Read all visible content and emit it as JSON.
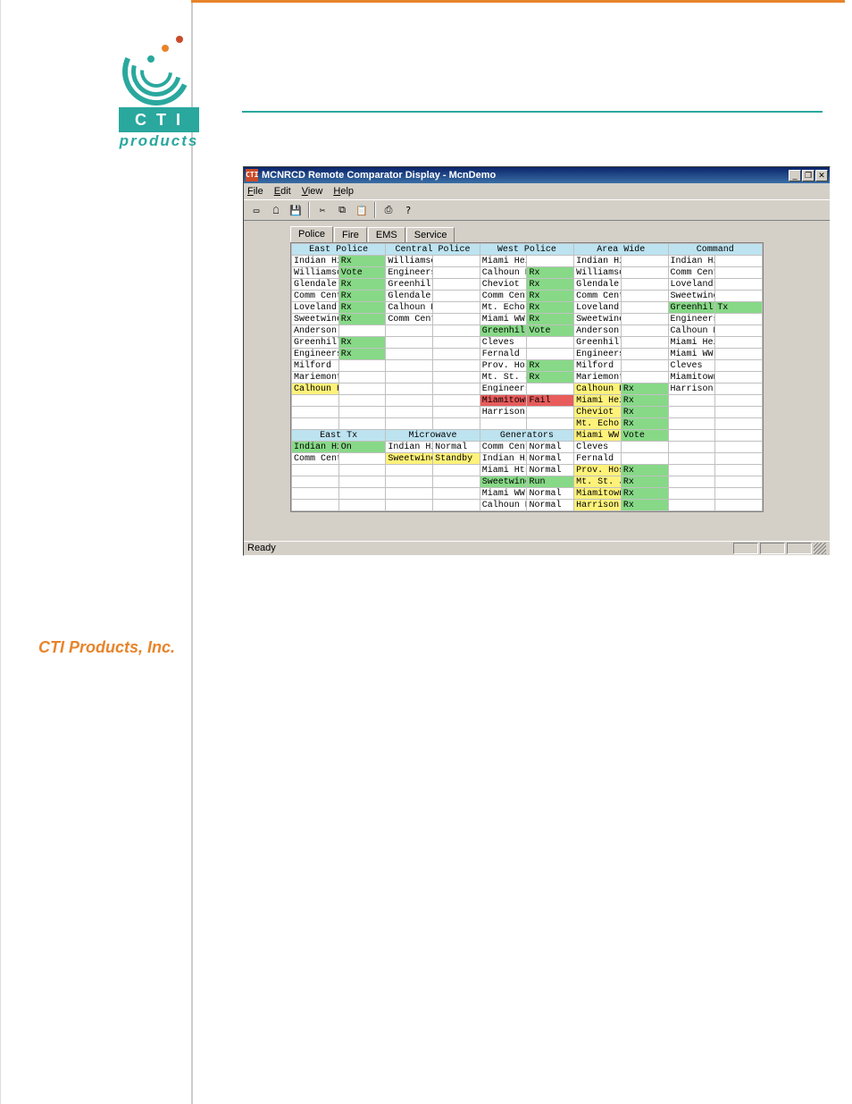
{
  "logo": {
    "bar": "C T I",
    "sub": "products"
  },
  "company": "CTI Products, Inc.",
  "window": {
    "title": "MCNRCD Remote Comparator Display - McnDemo",
    "ticon": "CTI",
    "menus": [
      "File",
      "Edit",
      "View",
      "Help"
    ],
    "toolbar": [
      "new",
      "open",
      "save",
      "|",
      "cut",
      "copy",
      "paste",
      "|",
      "print",
      "help"
    ],
    "tabs": [
      "Police",
      "Fire",
      "EMS",
      "Service"
    ],
    "active_tab": 0,
    "status": "Ready",
    "winbtns": [
      "_",
      "❐",
      "✕"
    ]
  },
  "columns": [
    {
      "headers": [
        "East Police"
      ],
      "type": "site",
      "rows": [
        {
          "n": "Indian Hill",
          "s": "Rx",
          "c": "rx"
        },
        {
          "n": "Williamson Rd.",
          "s": "Vote",
          "c": "vote"
        },
        {
          "n": "Glendale W.T.",
          "s": "Rx",
          "c": "rx"
        },
        {
          "n": "Comm Center",
          "s": "Rx",
          "c": "rx"
        },
        {
          "n": "Loveland W.T.",
          "s": "Rx",
          "c": "rx"
        },
        {
          "n": "Sweetwine",
          "s": "Rx",
          "c": "rx"
        },
        {
          "n": "Anderson Twp",
          "s": ""
        },
        {
          "n": "Greenhills",
          "s": "Rx",
          "c": "rx"
        },
        {
          "n": "Engineers",
          "s": "Rx",
          "c": "rx"
        },
        {
          "n": "Milford",
          "s": ""
        },
        {
          "n": "Mariemont",
          "s": ""
        },
        {
          "n": "Calhoun Hall",
          "s": "",
          "nc": "yel"
        },
        {
          "n": "",
          "s": ""
        },
        {
          "n": "",
          "s": ""
        },
        {
          "n": "",
          "s": ""
        }
      ],
      "headers2": [
        "East Tx"
      ],
      "rows2": [
        {
          "n": "Indian Hill",
          "s": "On",
          "c": "on",
          "nc": "rx"
        },
        {
          "n": "Comm Center",
          "s": ""
        },
        {
          "n": "",
          "s": ""
        },
        {
          "n": "",
          "s": ""
        },
        {
          "n": "",
          "s": ""
        },
        {
          "n": "",
          "s": ""
        }
      ]
    },
    {
      "headers": [
        "Central Police"
      ],
      "type": "site",
      "rows": [
        {
          "n": "Williamson Rd.",
          "s": ""
        },
        {
          "n": "Engineers",
          "s": ""
        },
        {
          "n": "Greenhills",
          "s": ""
        },
        {
          "n": "Glendale W.T.",
          "s": ""
        },
        {
          "n": "Calhoun Hall",
          "s": ""
        },
        {
          "n": "Comm Center",
          "s": ""
        },
        {
          "n": "",
          "s": ""
        },
        {
          "n": "",
          "s": ""
        },
        {
          "n": "",
          "s": ""
        },
        {
          "n": "",
          "s": ""
        },
        {
          "n": "",
          "s": ""
        },
        {
          "n": "",
          "s": ""
        },
        {
          "n": "",
          "s": ""
        },
        {
          "n": "",
          "s": ""
        },
        {
          "n": "",
          "s": ""
        }
      ],
      "headers2": [
        "Microwave"
      ],
      "rows2": [
        {
          "n": "Indian Hill",
          "s": "Normal"
        },
        {
          "n": "Sweetwine",
          "s": "Standby",
          "c": "stb",
          "nc": "yel"
        },
        {
          "n": "",
          "s": ""
        },
        {
          "n": "",
          "s": ""
        },
        {
          "n": "",
          "s": ""
        },
        {
          "n": "",
          "s": ""
        }
      ]
    },
    {
      "headers": [
        "West Police"
      ],
      "type": "site",
      "rows": [
        {
          "n": "Miami Heights",
          "s": ""
        },
        {
          "n": "Calhoun Hall",
          "s": "Rx",
          "c": "rx"
        },
        {
          "n": "Cheviot",
          "s": "Rx",
          "c": "rx"
        },
        {
          "n": "Comm Center",
          "s": "Rx",
          "c": "rx"
        },
        {
          "n": "Mt. Echo",
          "s": "Rx",
          "c": "rx"
        },
        {
          "n": "Miami WW",
          "s": "Rx",
          "c": "rx"
        },
        {
          "n": "Greenhills",
          "s": "Vote",
          "c": "vote",
          "nc": "rx"
        },
        {
          "n": "Cleves",
          "s": ""
        },
        {
          "n": "Fernald",
          "s": ""
        },
        {
          "n": "Prov. Hosp.",
          "s": "Rx",
          "c": "rx"
        },
        {
          "n": "Mt. St. Joesph",
          "s": "Rx",
          "c": "rx"
        },
        {
          "n": "Engineers",
          "s": ""
        },
        {
          "n": "Miamitown",
          "s": "Fail",
          "c": "fail",
          "nc": "fail"
        },
        {
          "n": "Harrison",
          "s": ""
        },
        {
          "n": "",
          "s": ""
        }
      ],
      "headers2": [
        "Generators"
      ],
      "rows2": [
        {
          "n": "Comm Center",
          "s": "Normal"
        },
        {
          "n": "Indian Hill",
          "s": "Normal"
        },
        {
          "n": "Miami Hts",
          "s": "Normal"
        },
        {
          "n": "Sweetwine",
          "s": "Run",
          "c": "run",
          "nc": "rx"
        },
        {
          "n": "Miami WW",
          "s": "Normal"
        },
        {
          "n": "Calhoun Hall",
          "s": "Normal"
        }
      ]
    },
    {
      "headers": [
        "Area Wide"
      ],
      "type": "site",
      "rows": [
        {
          "n": "Indian Hill",
          "s": ""
        },
        {
          "n": "Williamson Rd",
          "s": ""
        },
        {
          "n": "Glendale W.T.",
          "s": ""
        },
        {
          "n": "Comm Center",
          "s": ""
        },
        {
          "n": "Loveland W.T.",
          "s": ""
        },
        {
          "n": "Sweetwine",
          "s": ""
        },
        {
          "n": "Anderson Twp.",
          "s": ""
        },
        {
          "n": "Greenhills",
          "s": ""
        },
        {
          "n": "Engineers",
          "s": ""
        },
        {
          "n": "Milford",
          "s": ""
        },
        {
          "n": "Mariemont",
          "s": ""
        },
        {
          "n": "Calhoun Hall",
          "s": "Rx",
          "c": "rx",
          "nc": "yel"
        },
        {
          "n": "Miami Heights",
          "s": "Rx",
          "c": "rx",
          "nc": "yel"
        },
        {
          "n": "Cheviot",
          "s": "Rx",
          "c": "rx",
          "nc": "yel"
        },
        {
          "n": "Mt. Echo",
          "s": "Rx",
          "c": "rx",
          "nc": "yel"
        },
        {
          "n": "Miami WW",
          "s": "Vote",
          "c": "vote",
          "nc": "yel"
        },
        {
          "n": "Cleves",
          "s": ""
        },
        {
          "n": "Fernald",
          "s": ""
        },
        {
          "n": "Prov. Hosp.",
          "s": "Rx",
          "c": "rx",
          "nc": "yel"
        },
        {
          "n": "Mt. St. Joesph",
          "s": "Rx",
          "c": "rx",
          "nc": "yel"
        },
        {
          "n": "Miamitown",
          "s": "Rx",
          "c": "rx",
          "nc": "yel"
        },
        {
          "n": "Harrison",
          "s": "Rx",
          "c": "rx",
          "nc": "yel"
        }
      ]
    },
    {
      "headers": [
        "Command"
      ],
      "type": "list",
      "rows": [
        {
          "n": "Indian Hill",
          "s": ""
        },
        {
          "n": "Comm Center",
          "s": ""
        },
        {
          "n": "Loveland W.T.",
          "s": ""
        },
        {
          "n": "Sweetwine",
          "s": ""
        },
        {
          "n": "Greenhills",
          "s": "Tx",
          "c": "tx",
          "nc": "rx"
        },
        {
          "n": "Engineers",
          "s": ""
        },
        {
          "n": "Calhoun Hall",
          "s": ""
        },
        {
          "n": "Miami Heights",
          "s": ""
        },
        {
          "n": "Miami WW",
          "s": ""
        },
        {
          "n": "Cleves",
          "s": ""
        },
        {
          "n": "Miamitown",
          "s": "",
          "u": true
        },
        {
          "n": "Harrison",
          "s": "",
          "u": true
        }
      ]
    }
  ],
  "toolbar_glyphs": {
    "new": "▭",
    "open": "☖",
    "save": "💾",
    "cut": "✂",
    "copy": "⧉",
    "paste": "📋",
    "print": "⎙",
    "help": "?"
  }
}
